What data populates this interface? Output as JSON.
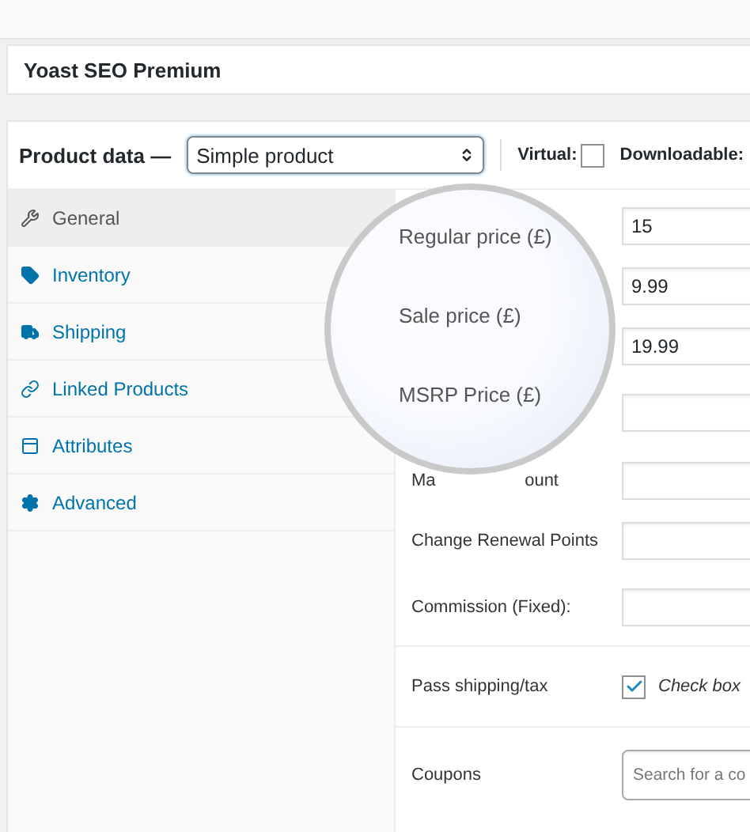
{
  "seo_box": {
    "title": "Yoast SEO Premium"
  },
  "product_data": {
    "label": "Product data —",
    "type_select": {
      "value": "Simple product"
    },
    "options": [
      {
        "label": "Virtual:",
        "kind": "checkbox",
        "checked": false
      },
      {
        "label": "Downloadable:",
        "kind": "text"
      }
    ]
  },
  "tabs": [
    {
      "label": "General",
      "selected": true
    },
    {
      "label": "Inventory",
      "selected": false
    },
    {
      "label": "Shipping",
      "selected": false
    },
    {
      "label": "Linked Products",
      "selected": false
    },
    {
      "label": "Attributes",
      "selected": false
    },
    {
      "label": "Advanced",
      "selected": false
    }
  ],
  "fields": [
    {
      "kind": "input",
      "value": "15"
    },
    {
      "kind": "input",
      "value": "9.99"
    },
    {
      "kind": "input",
      "value": "19.99"
    },
    {
      "kind": "input"
    },
    {
      "kind": "input",
      "label_parts": [
        "Ma",
        "ount"
      ]
    },
    {
      "kind": "input",
      "label": "Change Renewal Points"
    },
    {
      "kind": "input",
      "label": "Commission (Fixed):"
    },
    {
      "kind": "checkbox",
      "label": "Pass shipping/tax",
      "checked": true,
      "note": "Check box"
    },
    {
      "kind": "search",
      "label": "Coupons",
      "placeholder": "Search for a co"
    }
  ],
  "magnifier": {
    "labels": [
      "Regular price (£)",
      "Sale price (£)",
      "MSRP Price (£)"
    ]
  }
}
